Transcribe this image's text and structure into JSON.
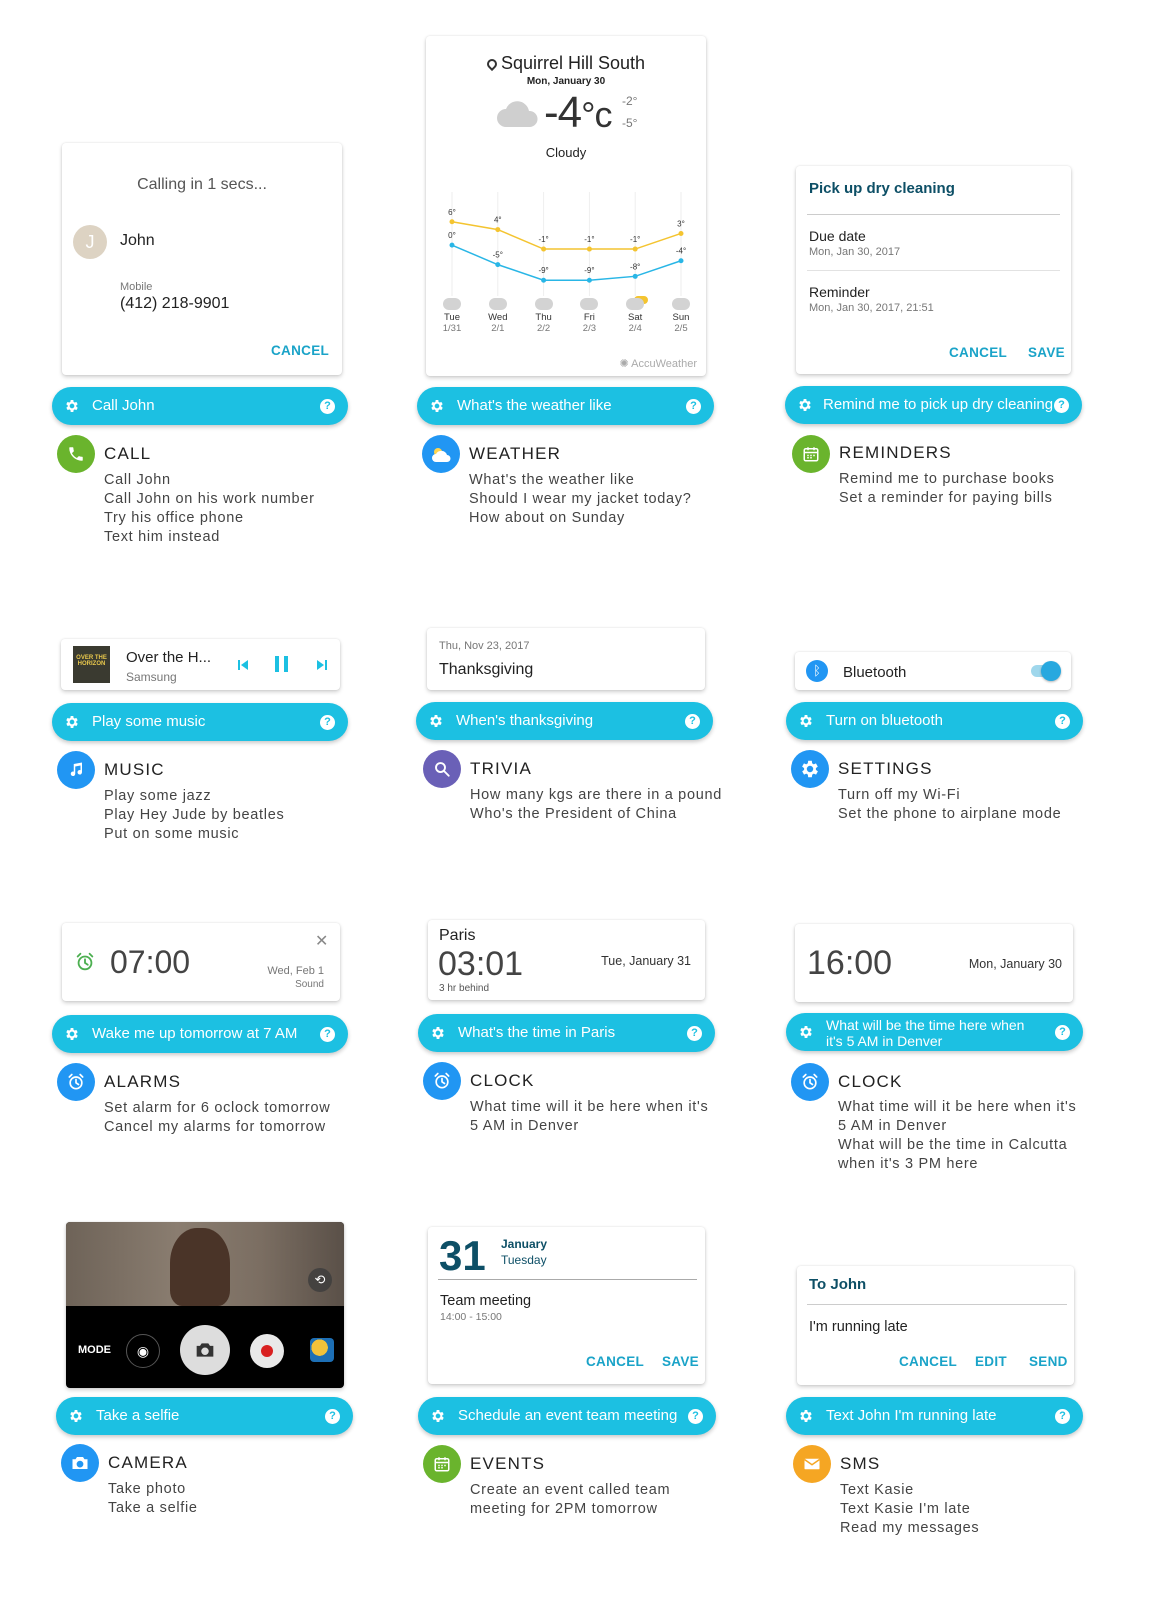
{
  "call": {
    "card": {
      "status": "Calling in 1 secs...",
      "avatar_letter": "J",
      "name": "John",
      "number_type": "Mobile",
      "number": "(412) 218-9901",
      "cancel": "CANCEL"
    },
    "query": "Call John",
    "title": "CALL",
    "examples": [
      "Call John",
      "Call John on his work number",
      "Try his office phone",
      "Text him instead"
    ]
  },
  "weather": {
    "card": {
      "location": "Squirrel Hill South",
      "date": "Mon, January 30",
      "temp": "-4",
      "unit": "°c",
      "high": "-2°",
      "low": "-5°",
      "condition": "Cloudy",
      "provider": "AccuWeather",
      "days": [
        {
          "day": "Tue",
          "date": "1/31"
        },
        {
          "day": "Wed",
          "date": "2/1"
        },
        {
          "day": "Thu",
          "date": "2/2"
        },
        {
          "day": "Fri",
          "date": "2/3"
        },
        {
          "day": "Sat",
          "date": "2/4"
        },
        {
          "day": "Sun",
          "date": "2/5"
        }
      ],
      "high_labels": [
        "6°",
        "4°",
        "-1°",
        "-1°",
        "-1°",
        "3°"
      ],
      "low_labels": [
        "0°",
        "-5°",
        "-9°",
        "-9°",
        "-8°",
        "-4°"
      ]
    },
    "query": "What's the weather like",
    "title": "WEATHER",
    "examples": [
      "What's the weather like",
      "Should I wear my jacket today?",
      "How about on Sunday"
    ]
  },
  "chart_data": {
    "type": "line",
    "categories": [
      "Tue 1/31",
      "Wed 2/1",
      "Thu 2/2",
      "Fri 2/3",
      "Sat 2/4",
      "Sun 2/5"
    ],
    "series": [
      {
        "values": [
          6,
          4,
          -1,
          -1,
          -1,
          3
        ]
      },
      {
        "values": [
          0,
          -5,
          -9,
          -9,
          -8,
          -4
        ]
      }
    ],
    "colors": [
      "#f4c430",
      "#29b6e6"
    ]
  },
  "reminders": {
    "card": {
      "title": "Pick up dry cleaning",
      "due_label": "Due date",
      "due_value": "Mon, Jan 30, 2017",
      "rem_label": "Reminder",
      "rem_value": "Mon, Jan 30, 2017, 21:51",
      "cancel": "CANCEL",
      "save": "SAVE"
    },
    "query": "Remind me to pick up dry cleaning",
    "title": "REMINDERS",
    "examples": [
      "Remind me to purchase books",
      "Set a reminder for paying bills"
    ]
  },
  "music": {
    "card": {
      "album_art_text": "OVER THE HORIZON",
      "track": "Over the H...",
      "artist": "Samsung"
    },
    "query": "Play some music",
    "title": "MUSIC",
    "examples": [
      "Play some jazz",
      "Play Hey Jude by beatles",
      "Put on some music"
    ]
  },
  "trivia": {
    "card": {
      "date": "Thu, Nov 23, 2017",
      "answer": "Thanksgiving"
    },
    "query": "When's thanksgiving",
    "title": "TRIVIA",
    "examples": [
      "How many kgs are there in a pound",
      "Who's the President of China"
    ]
  },
  "settings": {
    "card": {
      "label": "Bluetooth"
    },
    "query": "Turn on bluetooth",
    "title": "SETTINGS",
    "examples": [
      "Turn off my Wi-Fi",
      "Set the phone to airplane mode"
    ]
  },
  "alarms": {
    "card": {
      "time": "07:00",
      "date": "Wed, Feb 1",
      "sound": "Sound"
    },
    "query": "Wake me up tomorrow at 7 AM",
    "title": "ALARMS",
    "examples": [
      "Set alarm for 6 oclock tomorrow",
      "Cancel my alarms for tomorrow"
    ]
  },
  "clock1": {
    "card": {
      "city": "Paris",
      "time": "03:01",
      "offset": "3 hr behind",
      "date": "Tue, January 31"
    },
    "query": "What's the time in Paris",
    "title": "CLOCK",
    "examples": [
      "What time will it be here when it's",
      "5 AM in Denver"
    ]
  },
  "clock2": {
    "card": {
      "time": "16:00",
      "date": "Mon, January 30"
    },
    "query_line1": "What will be the time here when",
    "query_line2": "it's 5 AM in Denver",
    "title": "CLOCK",
    "examples": [
      "What time will it be here when it's",
      "5 AM in Denver",
      "What will be the time in Calcutta",
      "when it's 3 PM here"
    ]
  },
  "camera": {
    "card": {
      "mode": "MODE"
    },
    "query": "Take a selfie",
    "title": "CAMERA",
    "examples": [
      "Take photo",
      "Take a selfie"
    ]
  },
  "events": {
    "card": {
      "day": "31",
      "month": "January",
      "weekday": "Tuesday",
      "event": "Team meeting",
      "time": "14:00 - 15:00",
      "cancel": "CANCEL",
      "save": "SAVE"
    },
    "query": "Schedule an event team meeting",
    "title": "EVENTS",
    "examples": [
      "Create an event called team",
      "meeting for 2PM tomorrow"
    ]
  },
  "sms": {
    "card": {
      "to": "To John",
      "message": "I'm running late",
      "cancel": "CANCEL",
      "edit": "EDIT",
      "send": "SEND"
    },
    "query": "Text John I'm running late",
    "title": "SMS",
    "examples": [
      "Text Kasie",
      "Text Kasie I'm late",
      "Read my messages"
    ]
  },
  "colors": {
    "accent": "#1cc0e2",
    "link": "#1aa3c8",
    "green": "#6ab42d",
    "blue": "#2196f3",
    "purple": "#6a60b7",
    "orange": "#f5a623",
    "dark_teal": "#0d4f66"
  }
}
